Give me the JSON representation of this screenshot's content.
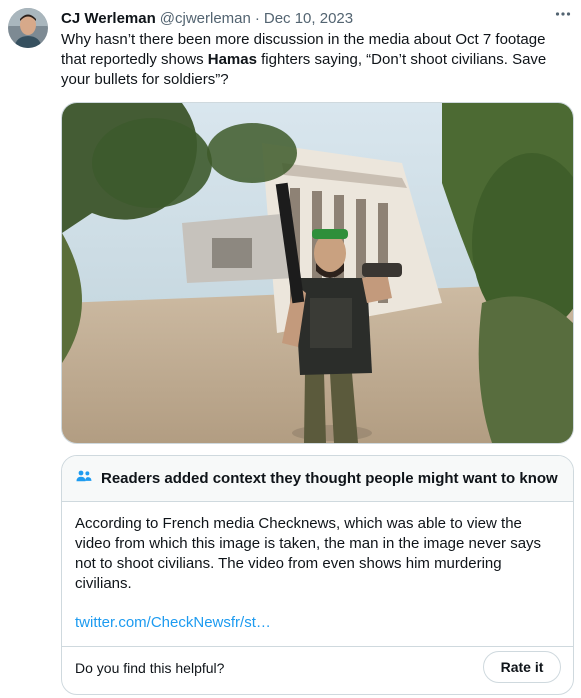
{
  "author": {
    "name": "CJ Werleman",
    "handle": "@cjwerleman",
    "separator": "·",
    "date": "Dec 10, 2023"
  },
  "tweet": {
    "text_part1": "Why hasn’t there been more discussion in the media about Oct 7 footage that reportedly shows ",
    "text_bold": "Hamas",
    "text_part2": " fighters saying, “Don’t shoot civilians. Save your bullets for soldiers”?"
  },
  "media": {
    "description_icon": "photo"
  },
  "community_note": {
    "header": "Readers added context they thought people might want to know",
    "body": "According to French media Checknews, which was able to view the video from which this image is taken, the man in the image never says not to shoot civilians. The video from even shows him murdering civilians.",
    "link": "twitter.com/CheckNewsfr/st…",
    "helpful_prompt": "Do you find this helpful?",
    "rate_button": "Rate it"
  },
  "colors": {
    "text": "#0f1419",
    "secondary": "#536471",
    "link": "#1d9bf0",
    "border": "#cfd9de",
    "note_header_bg": "#f7f9f9"
  }
}
